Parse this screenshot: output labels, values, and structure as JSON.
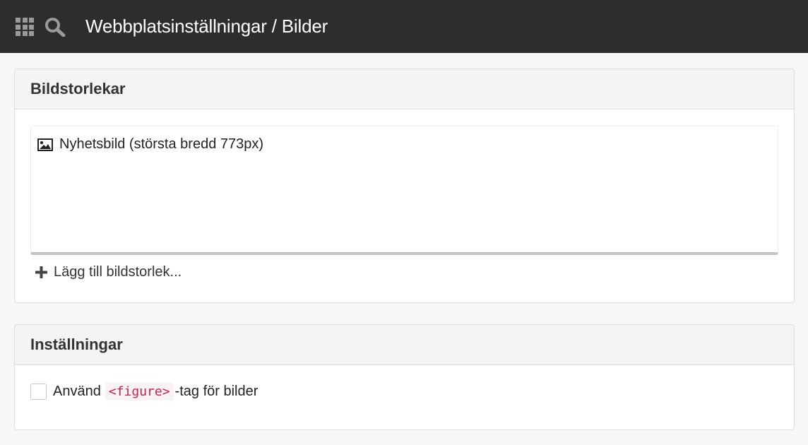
{
  "topbar": {
    "title": "Webbplatsinställningar / Bilder",
    "menu_icon": "grid-icon",
    "search_icon": "search-icon"
  },
  "image_sizes": {
    "title": "Bildstorlekar",
    "items": [
      {
        "label": "Nyhetsbild (största bredd 773px)",
        "icon": "image-icon"
      }
    ],
    "add_label": "Lägg till bildstorlek..."
  },
  "settings": {
    "title": "Inställningar",
    "figure_option": {
      "prefix": "Använd",
      "code": "<figure>",
      "suffix": "-tag för bilder",
      "checked": false
    }
  },
  "colors": {
    "topbar_bg": "#2d2d2d",
    "code_text": "#c7254e",
    "code_bg": "#f9f2f4"
  }
}
